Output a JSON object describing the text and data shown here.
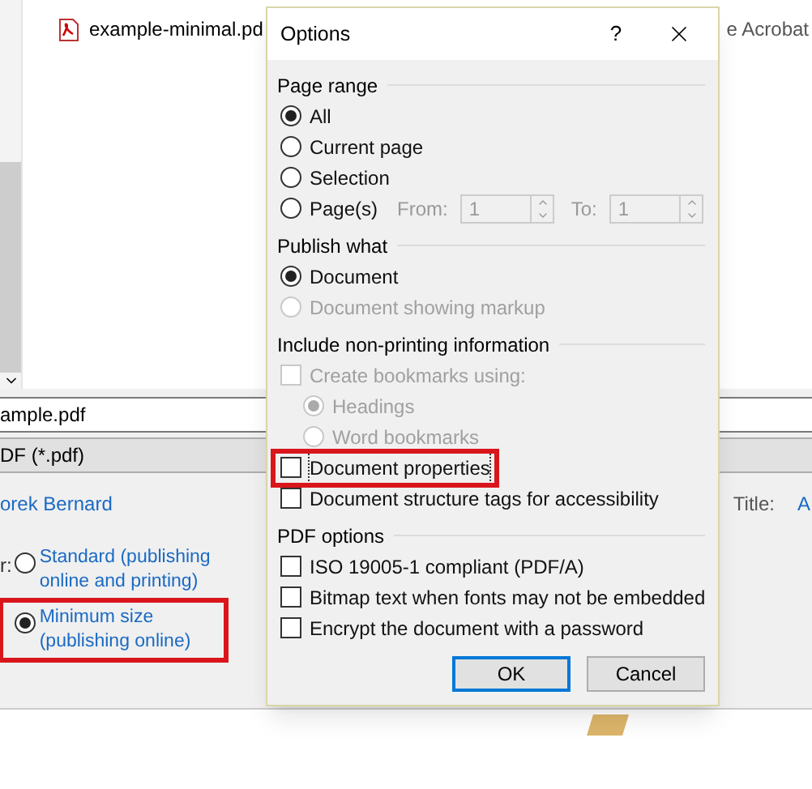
{
  "background": {
    "files": [
      {
        "name": "example-minimal.pd",
        "app": "e Acrobat"
      }
    ],
    "file_name": "ample.pdf",
    "file_type": "DF (*.pdf)",
    "author": "orek Bernard",
    "title_label": "Title:",
    "title_value": "A",
    "optimize_label": "r:",
    "optimize": [
      {
        "label": "Standard (publishing online and printing)",
        "selected": false,
        "highlighted": false
      },
      {
        "label": "Minimum size (publishing online)",
        "selected": true,
        "highlighted": true
      }
    ]
  },
  "dialog": {
    "title": "Options",
    "help": "?",
    "sections": [
      {
        "title": "Page range",
        "items": [
          {
            "kind": "radio",
            "label": "All",
            "selected": true,
            "disabled": false
          },
          {
            "kind": "radio",
            "label": "Current page",
            "selected": false,
            "disabled": false
          },
          {
            "kind": "radio",
            "label": "Selection",
            "selected": false,
            "disabled": false
          },
          {
            "kind": "range",
            "label": "Page(s)",
            "selected": false,
            "disabled": false,
            "from_label": "From:",
            "from_value": "1",
            "to_label": "To:",
            "to_value": "1",
            "fields_disabled": true
          }
        ]
      },
      {
        "title": "Publish what",
        "items": [
          {
            "kind": "radio",
            "label": "Document",
            "selected": true,
            "disabled": false
          },
          {
            "kind": "radio",
            "label": "Document showing markup",
            "selected": false,
            "disabled": true
          }
        ]
      },
      {
        "title": "Include non-printing information",
        "items": [
          {
            "kind": "checkbox",
            "label": "Create bookmarks using:",
            "checked": false,
            "disabled": true,
            "highlighted": false,
            "children": [
              {
                "kind": "radio",
                "label": "Headings",
                "selected": true,
                "disabled": true
              },
              {
                "kind": "radio",
                "label": "Word bookmarks",
                "selected": false,
                "disabled": true
              }
            ]
          },
          {
            "kind": "checkbox",
            "label": "Document properties",
            "checked": false,
            "disabled": false,
            "highlighted": true
          },
          {
            "kind": "checkbox",
            "label": "Document structure tags for accessibility",
            "checked": false,
            "disabled": false,
            "highlighted": false
          }
        ]
      },
      {
        "title": "PDF options",
        "items": [
          {
            "kind": "checkbox",
            "label": "ISO 19005-1 compliant (PDF/A)",
            "checked": false,
            "disabled": false,
            "highlighted": false
          },
          {
            "kind": "checkbox",
            "label": "Bitmap text when fonts may not be embedded",
            "checked": false,
            "disabled": false,
            "highlighted": false
          },
          {
            "kind": "checkbox",
            "label": "Encrypt the document with a password",
            "checked": false,
            "disabled": false,
            "highlighted": false
          }
        ]
      }
    ],
    "buttons": [
      {
        "label": "OK",
        "default": true
      },
      {
        "label": "Cancel",
        "default": false
      }
    ]
  }
}
